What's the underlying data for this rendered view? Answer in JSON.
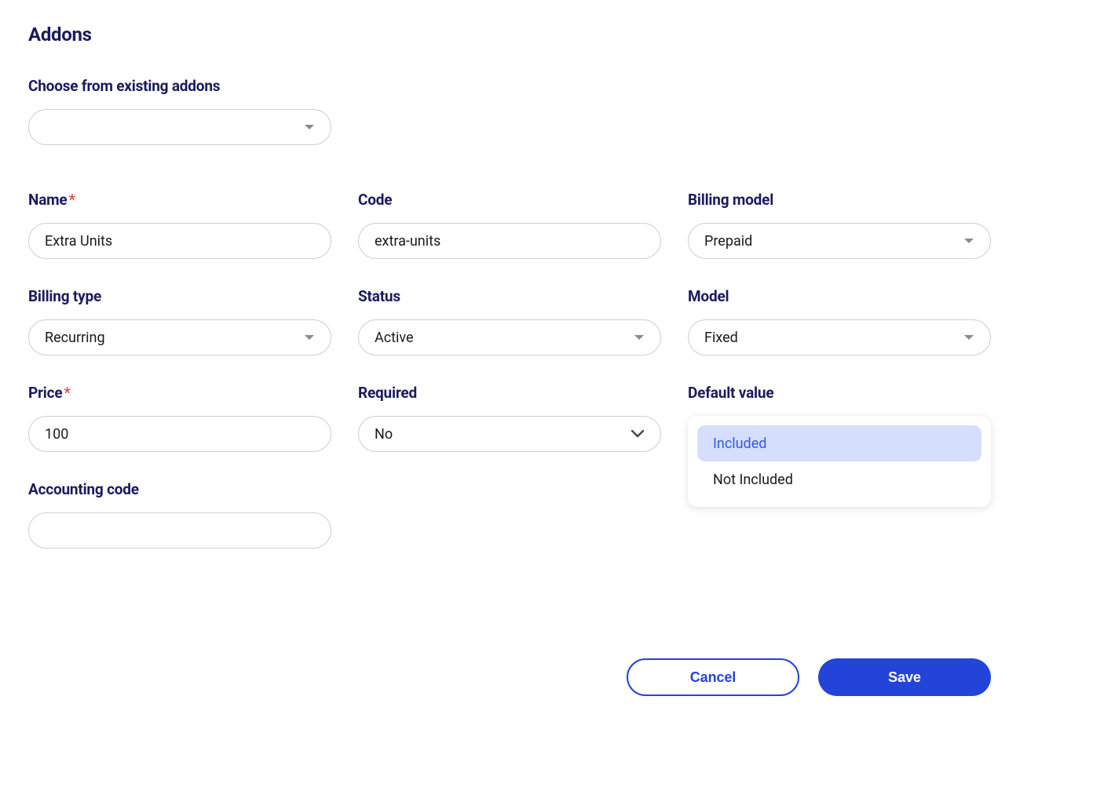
{
  "page_title": "Addons",
  "existing": {
    "label": "Choose from existing addons",
    "value": ""
  },
  "fields": {
    "name": {
      "label": "Name",
      "required": true,
      "value": "Extra Units"
    },
    "code": {
      "label": "Code",
      "required": false,
      "value": "extra-units"
    },
    "billing_model": {
      "label": "Billing model",
      "value": "Prepaid"
    },
    "billing_type": {
      "label": "Billing type",
      "value": "Recurring"
    },
    "status": {
      "label": "Status",
      "value": "Active"
    },
    "model": {
      "label": "Model",
      "value": "Fixed"
    },
    "price": {
      "label": "Price",
      "required": true,
      "value": "100"
    },
    "required": {
      "label": "Required",
      "value": "No"
    },
    "default_value": {
      "label": "Default value",
      "options": [
        {
          "label": "Included",
          "selected": true
        },
        {
          "label": "Not Included",
          "selected": false
        }
      ]
    },
    "accounting_code": {
      "label": "Accounting code",
      "value": ""
    }
  },
  "buttons": {
    "cancel": "Cancel",
    "save": "Save"
  }
}
